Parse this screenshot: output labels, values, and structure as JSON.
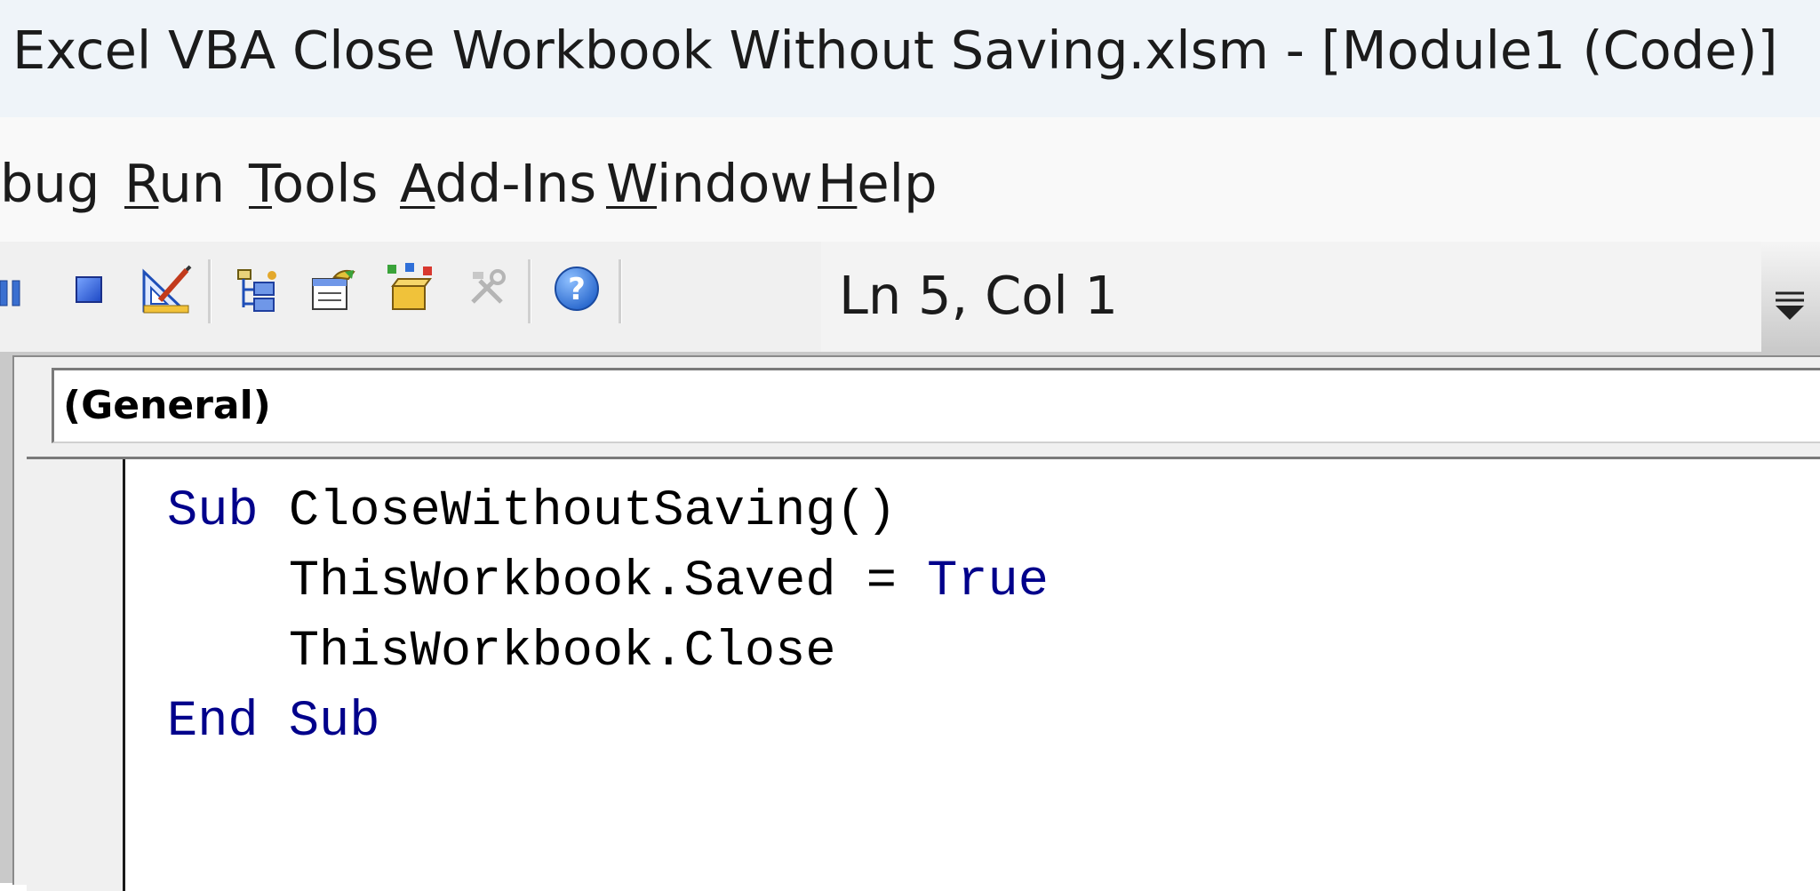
{
  "window": {
    "title": "Excel VBA Close Workbook Without Saving.xlsm - [Module1 (Code)]"
  },
  "menu": {
    "items": [
      {
        "pre": "",
        "key": "",
        "post": "bug"
      },
      {
        "pre": "",
        "key": "R",
        "post": "un"
      },
      {
        "pre": "",
        "key": "T",
        "post": "ools"
      },
      {
        "pre": "",
        "key": "A",
        "post": "dd-Ins"
      },
      {
        "pre": "",
        "key": "W",
        "post": "indow"
      },
      {
        "pre": "",
        "key": "H",
        "post": "elp"
      }
    ]
  },
  "toolbar": {
    "icons": [
      "pause-icon",
      "stop-icon",
      "design-mode-icon",
      "project-explorer-icon",
      "properties-window-icon",
      "object-browser-icon",
      "toolbox-icon",
      "help-icon"
    ],
    "status": "Ln 5, Col 1"
  },
  "code_window": {
    "procedure": "(General)",
    "lines": [
      [
        {
          "t": "Sub ",
          "kw": true
        },
        {
          "t": "CloseWithoutSaving()",
          "kw": false
        }
      ],
      [
        {
          "t": "    ThisWorkbook.Saved = ",
          "kw": false
        },
        {
          "t": "True",
          "kw": true
        }
      ],
      [
        {
          "t": "    ThisWorkbook.Close",
          "kw": false
        }
      ],
      [
        {
          "t": "End Sub",
          "kw": true
        }
      ]
    ]
  },
  "colors": {
    "keyword": "#00008b",
    "text": "#000000",
    "titlebar": "#eff4f9",
    "toolbar": "#f0f0f0"
  }
}
